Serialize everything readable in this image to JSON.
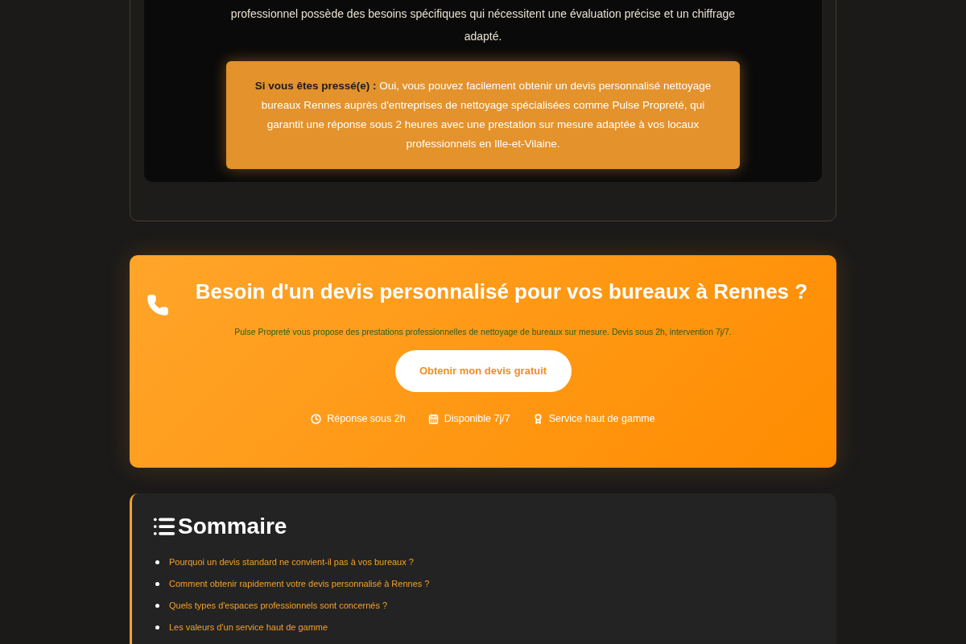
{
  "intro": {
    "lines": [
      "professionnel possède des besoins spécifiques qui nécessitent une évaluation précise et un chiffrage",
      "adapté."
    ]
  },
  "callout": {
    "text": "**Si vous êtes pressé(e) :** Oui, vous pouvez facilement obtenir un devis personnalisé nettoyage bureaux Rennes auprès d'entreprises de nettoyage spécialisées comme Pulse Propreté, qui garantit une réponse sous 2 heures avec une prestation sur mesure adaptée à vos locaux professionnels en Ille-et-Vilaine."
  },
  "cta": {
    "title": "Besoin d'un devis personnalisé pour vos bureaux à Rennes ?",
    "subtitle": "Pulse Propreté vous propose des prestations professionnelles de nettoyage de bureaux sur mesure. Devis sous 2h, intervention 7j/7.",
    "button": "Obtenir mon devis gratuit",
    "features": [
      {
        "kind": "clock",
        "label": "Réponse sous 2h"
      },
      {
        "kind": "calendar",
        "label": "Disponible 7j/7"
      },
      {
        "kind": "award",
        "label": "Service haut de gamme"
      }
    ]
  },
  "summary": {
    "title": "Sommaire",
    "items": [
      "Pourquoi un devis standard ne convient-il pas à vos bureaux ?",
      "Comment obtenir rapidement votre devis personnalisé à Rennes ?",
      "Quels types d'espaces professionnels sont concernés ?",
      "Les valeurs d'un service haut de gamme"
    ]
  }
}
